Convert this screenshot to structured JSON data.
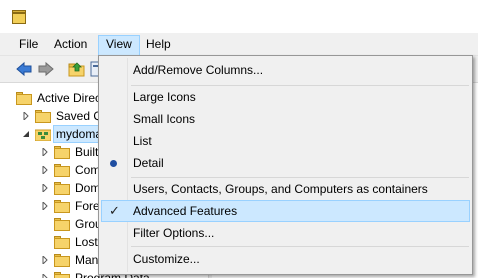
{
  "menubar": {
    "file": "File",
    "action": "Action",
    "view": "View",
    "help": "Help"
  },
  "toolbar": {
    "icons": [
      "arrow-left-icon",
      "arrow-right-icon",
      "folder-up-icon"
    ]
  },
  "tree": {
    "root": "Active Directory Users and Computers",
    "saved": "Saved Queries",
    "domain": "mydomain",
    "children": [
      "Builtin",
      "Computers",
      "Domain Controllers",
      "ForeignSecurityPrincipals",
      "Groups",
      "LostAndFound",
      "Managed Service Accounts",
      "Program Data"
    ]
  },
  "view_menu": {
    "items": {
      "add_remove_columns": "Add/Remove Columns...",
      "large_icons": "Large Icons",
      "small_icons": "Small Icons",
      "list": "List",
      "detail": "Detail",
      "users_containers": "Users, Contacts, Groups, and Computers as containers",
      "advanced_features": "Advanced Features",
      "filter_options": "Filter Options...",
      "customize": "Customize..."
    },
    "selected_view": "Detail",
    "checked": "Advanced Features",
    "check_mark": "✓"
  },
  "colors": {
    "highlight_bg": "#cce8ff",
    "highlight_border": "#99d1ff",
    "radio": "#1f4ea1",
    "folder": "#f6d36a"
  }
}
